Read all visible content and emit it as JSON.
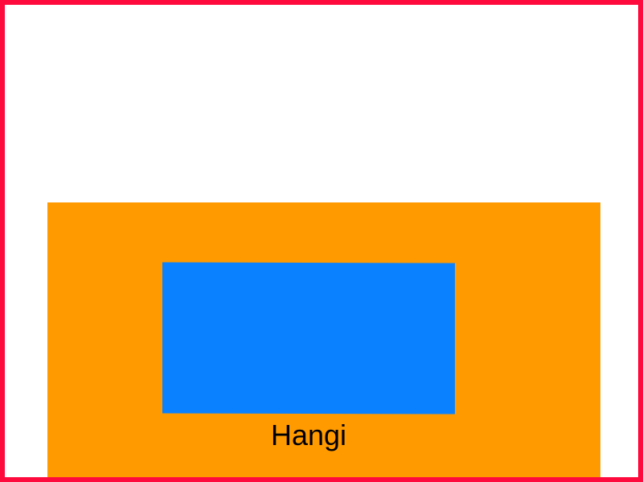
{
  "colors": {
    "border": "#FF0A3C",
    "background": "#FFFFFF",
    "panel": "#FF9A00",
    "rectangle": "#0A82FF",
    "text": "#000000"
  },
  "diagram": {
    "label": "Hangi"
  }
}
